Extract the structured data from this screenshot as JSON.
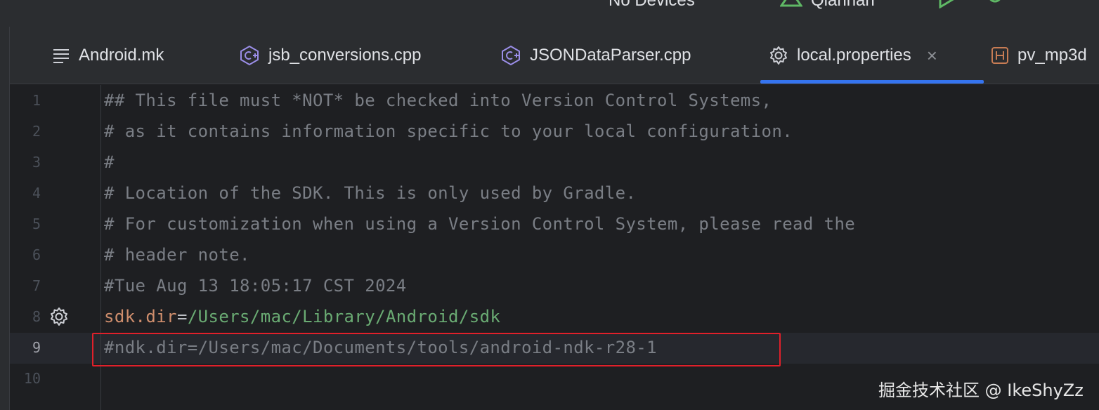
{
  "toolbar": {
    "device_label": "No Devices",
    "profile_label": "Qianhan",
    "colors": {
      "run": "#5fb865",
      "debug": "#5fb865",
      "profile": "#5fb865"
    }
  },
  "tabs": [
    {
      "label": "Android.mk",
      "icon": "lines-icon",
      "active": false
    },
    {
      "label": "jsb_conversions.cpp",
      "icon": "cpp-file-icon",
      "active": false
    },
    {
      "label": "JSONDataParser.cpp",
      "icon": "cpp-file-icon",
      "active": false
    },
    {
      "label": "local.properties",
      "icon": "gear-icon",
      "active": true,
      "close": "×"
    },
    {
      "label": "pv_mp3d",
      "icon": "header-file-icon",
      "active": false
    }
  ],
  "editor": {
    "lines": [
      {
        "n": "1",
        "text": "## This file must *NOT* be checked into Version Control Systems,"
      },
      {
        "n": "2",
        "text": "# as it contains information specific to your local configuration."
      },
      {
        "n": "3",
        "text": "#"
      },
      {
        "n": "4",
        "text": "# Location of the SDK. This is only used by Gradle."
      },
      {
        "n": "5",
        "text": "# For customization when using a Version Control System, please read the"
      },
      {
        "n": "6",
        "text": "# header note."
      },
      {
        "n": "7",
        "text": "#Tue Aug 13 18:05:17 CST 2024"
      },
      {
        "n": "8",
        "key": "sdk.dir",
        "op": "=",
        "value": "/Users/mac/Library/Android/sdk"
      },
      {
        "n": "9",
        "text": "#ndk.dir=/Users/mac/Documents/tools/android-ndk-r28-1"
      },
      {
        "n": "10",
        "text": ""
      }
    ],
    "current_line": 9
  },
  "watermark": "掘金技术社区 @ IkeShyZz",
  "colors": {
    "accent": "#3574f0",
    "highlight_box": "#e0202a",
    "comment": "#7a7e85",
    "key": "#cf8e6d",
    "value": "#6aab73"
  }
}
